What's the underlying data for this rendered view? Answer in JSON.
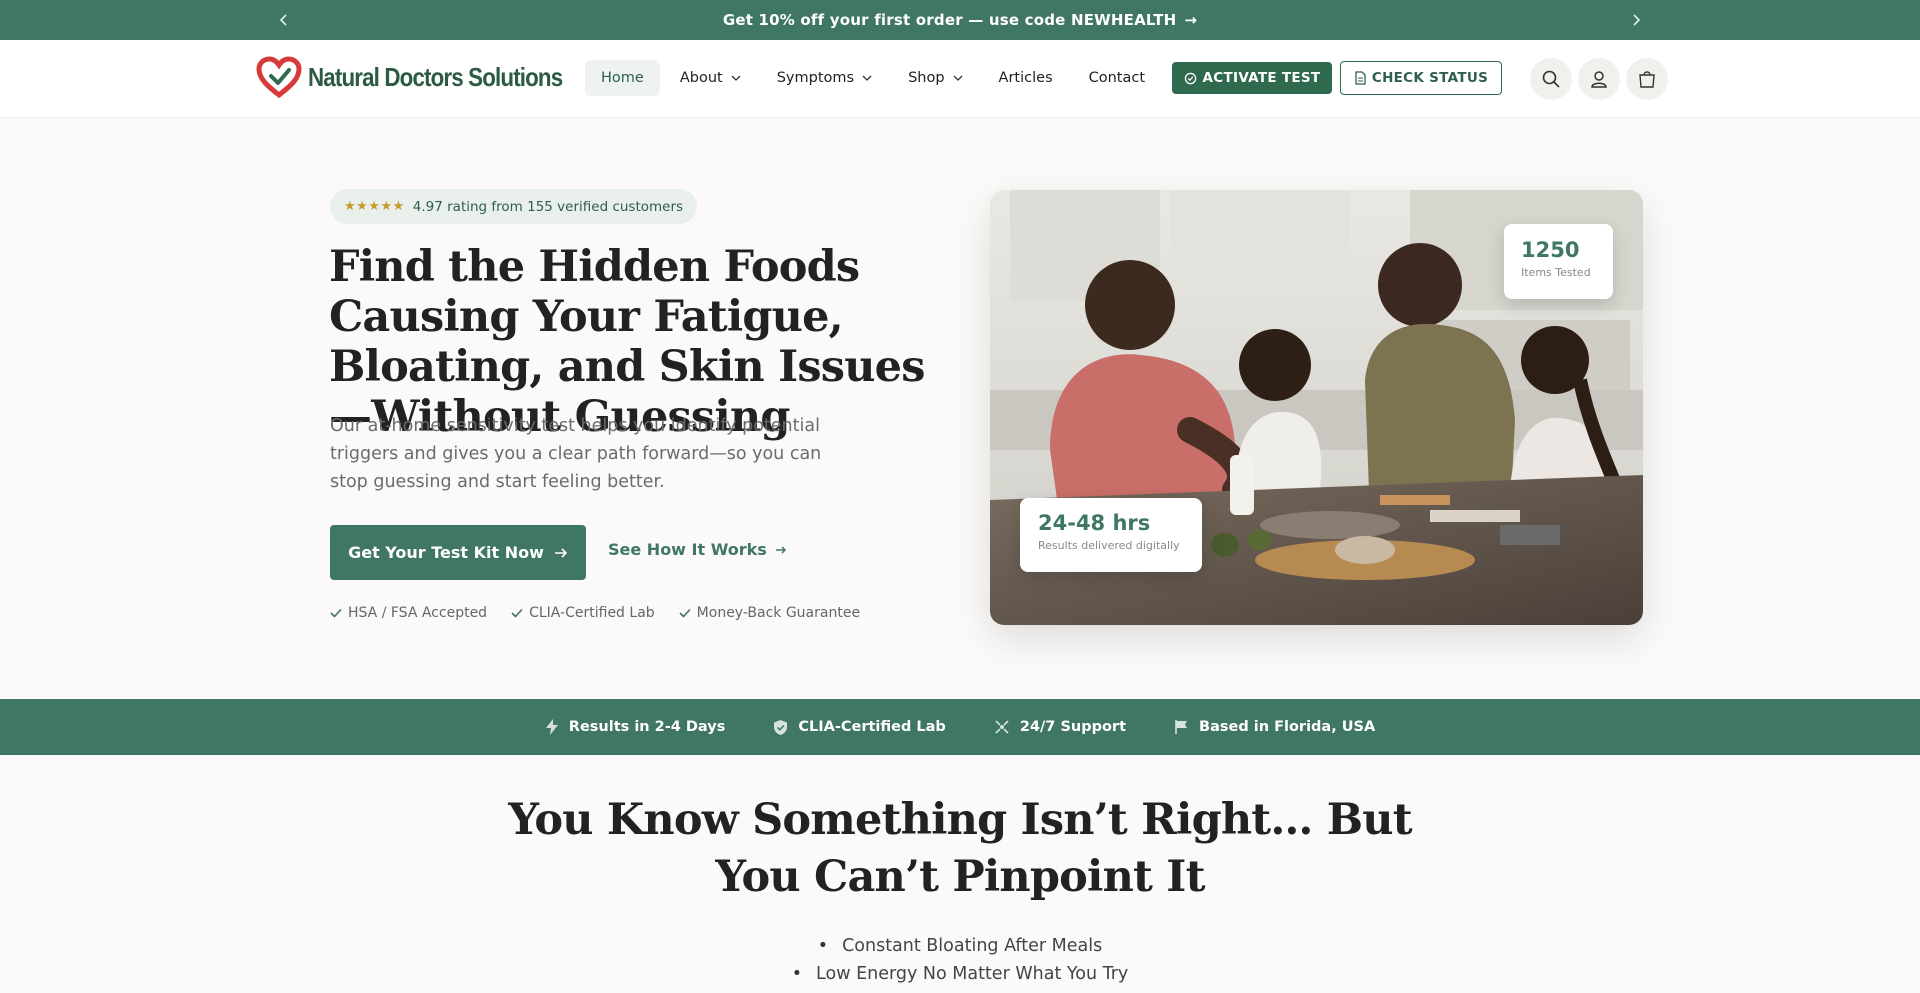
{
  "announcement": {
    "text": "Get 10% off your first order — use code NEWHEALTH",
    "arrow": "→"
  },
  "header": {
    "logo_text": "Natural Doctors Solutions",
    "nav": [
      {
        "label": "Home",
        "active": true,
        "dropdown": false
      },
      {
        "label": "About",
        "dropdown": true
      },
      {
        "label": "Symptoms",
        "dropdown": true
      },
      {
        "label": "Shop",
        "dropdown": true
      },
      {
        "label": "Articles",
        "dropdown": false
      },
      {
        "label": "Contact",
        "dropdown": false
      }
    ],
    "activate_label": "ACTIVATE TEST",
    "status_label": "CHECK STATUS",
    "icons": [
      "search-icon",
      "account-icon",
      "cart-icon"
    ]
  },
  "hero": {
    "rating_stars": "★★★★★",
    "rating_text": "4.97 rating from 155 verified customers",
    "title": "Find the Hidden Foods Causing Your Fatigue, Bloating, and Skin Issues—Without Guessing",
    "subtitle": "Our at-home sensitivity test helps you identify potential triggers and gives you a clear path forward—so you can stop guessing and start feeling better.",
    "cta_label": "Get Your Test Kit Now",
    "secondary_label": "See How It Works",
    "checks": [
      "HSA / FSA Accepted",
      "CLIA-Certified Lab",
      "Money-Back Guarantee"
    ],
    "stat_items": {
      "value": "1250",
      "label": "Items Tested"
    },
    "stat_results": {
      "value": "24-48 hrs",
      "label": "Results delivered digitally"
    }
  },
  "trust_bar": [
    {
      "icon": "bolt-icon",
      "label": "Results in 2-4 Days"
    },
    {
      "icon": "shield-icon",
      "label": "CLIA-Certified Lab"
    },
    {
      "icon": "support-icon",
      "label": "24/7 Support"
    },
    {
      "icon": "flag-icon",
      "label": "Based in Florida, USA"
    }
  ],
  "section2": {
    "title_line1": "You Know Something Isn’t Right… But",
    "title_line2": "You Can’t Pinpoint It",
    "items": [
      "Constant Bloating After Meals",
      "Low Energy No Matter What You Try"
    ]
  },
  "colors": {
    "brand": "#3f7665",
    "dark_green": "#2f6a4e",
    "logo_red": "#d63a3a"
  }
}
